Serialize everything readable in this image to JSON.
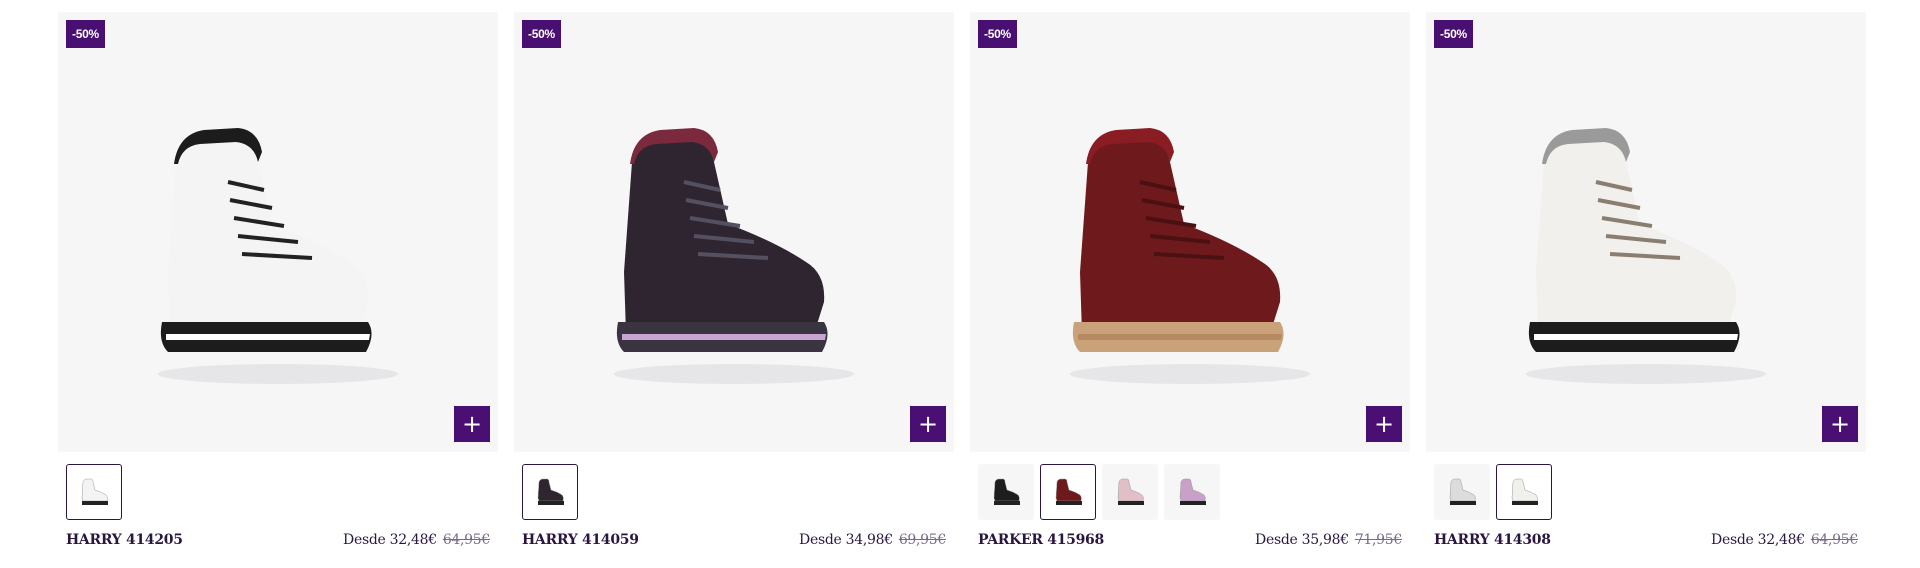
{
  "products": [
    {
      "badge": "-50%",
      "name": "HARRY 414205",
      "price_from": "Desde 32,48€",
      "price_old": "64,95€",
      "add_label": "+",
      "shoe": {
        "body": "#f4f4f4",
        "trim": "#222222",
        "sole": "#1c1c1c",
        "collar": "#1c1c1c",
        "stripe": "#ffffff"
      },
      "thumbs": [
        {
          "body": "#f4f4f4",
          "selected": true
        }
      ]
    },
    {
      "badge": "-50%",
      "name": "HARRY 414059",
      "price_from": "Desde 34,98€",
      "price_old": "69,95€",
      "add_label": "+",
      "shoe": {
        "body": "#2e2530",
        "trim": "#555060",
        "sole": "#3a3340",
        "collar": "#7a2a3c",
        "stripe": "#c9a6cf"
      },
      "thumbs": [
        {
          "body": "#2e2530",
          "selected": true
        }
      ]
    },
    {
      "badge": "-50%",
      "name": "PARKER 415968",
      "price_from": "Desde 35,98€",
      "price_old": "71,95€",
      "add_label": "+",
      "shoe": {
        "body": "#6e1a1c",
        "trim": "#4a1012",
        "sole": "#c9a27a",
        "collar": "#8a1c24",
        "stripe": "#b58a60"
      },
      "thumbs": [
        {
          "body": "#1e1e1e",
          "selected": false
        },
        {
          "body": "#6e1a1c",
          "selected": true
        },
        {
          "body": "#e2bfc6",
          "selected": false
        },
        {
          "body": "#c8a0c8",
          "selected": false
        }
      ]
    },
    {
      "badge": "-50%",
      "name": "HARRY 414308",
      "price_from": "Desde 32,48€",
      "price_old": "64,95€",
      "add_label": "+",
      "shoe": {
        "body": "#f2f0ec",
        "trim": "#8a7e70",
        "sole": "#1c1c1c",
        "collar": "#9a9a9a",
        "stripe": "#ffffff"
      },
      "thumbs": [
        {
          "body": "#dcdcdc",
          "selected": false
        },
        {
          "body": "#f2f0ec",
          "selected": true
        }
      ]
    }
  ]
}
